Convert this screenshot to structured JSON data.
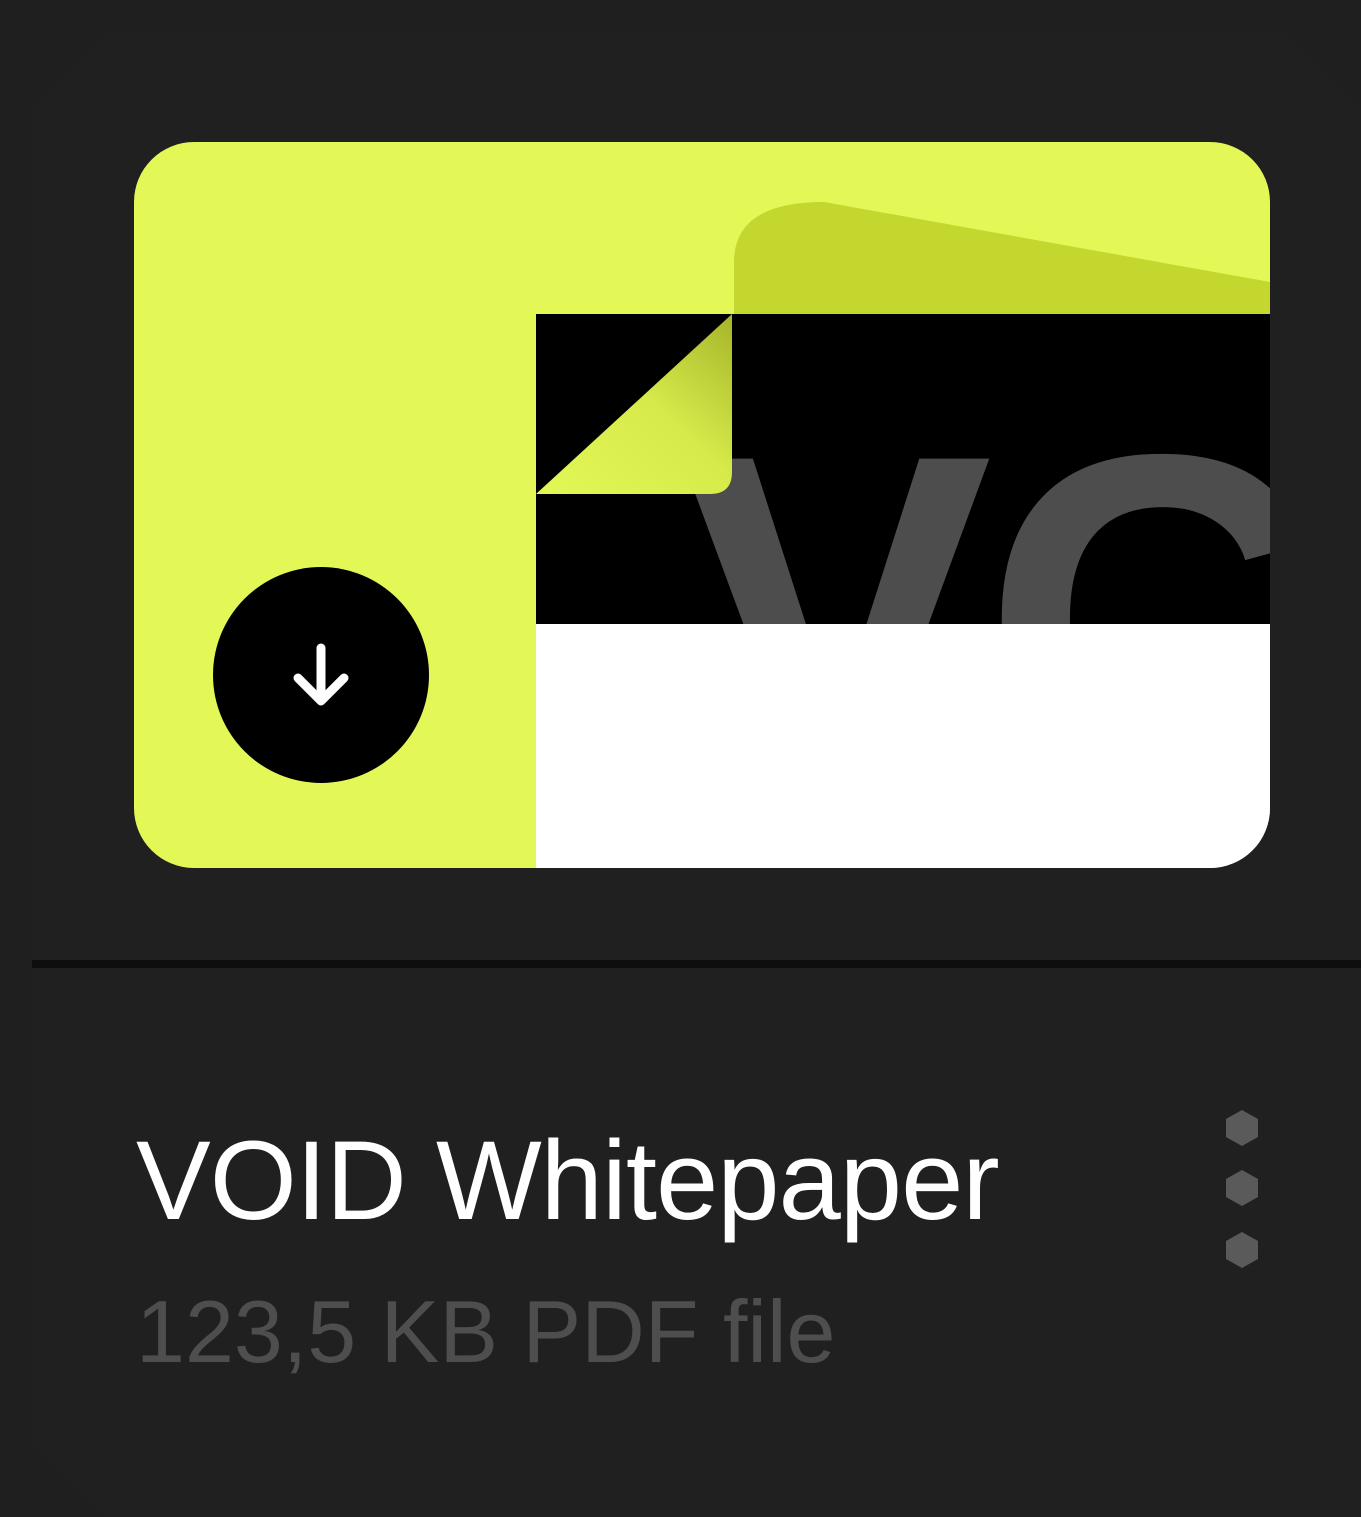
{
  "file_card": {
    "title": "VOID Whitepaper",
    "size": "123,5 KB",
    "type": "PDF file",
    "thumbnail_brand_text": "VC",
    "download_icon": "download-arrow-icon",
    "menu_icon": "more-vertical-icon"
  },
  "colors": {
    "background": "#1f1f1f",
    "card": "#202020",
    "accent": "#e3f757",
    "accent_shade": "#c3d72e",
    "title_text": "#ffffff",
    "meta_text": "#4e4e4e"
  }
}
